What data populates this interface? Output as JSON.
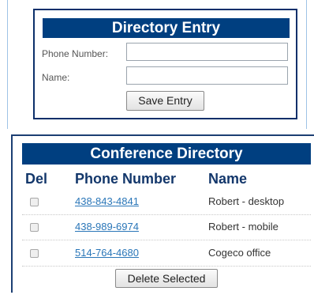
{
  "entry": {
    "title": "Directory Entry",
    "phone_label": "Phone Number:",
    "phone_value": "",
    "name_label": "Name:",
    "name_value": "",
    "save_label": "Save Entry"
  },
  "directory": {
    "title": "Conference Directory",
    "columns": {
      "del": "Del",
      "phone": "Phone Number",
      "name": "Name"
    },
    "rows": [
      {
        "phone": "438-843-4841",
        "name": "Robert - desktop",
        "checked": false
      },
      {
        "phone": "438-989-6974",
        "name": "Robert - mobile",
        "checked": false
      },
      {
        "phone": "514-764-4680",
        "name": "Cogeco office",
        "checked": false
      }
    ],
    "delete_label": "Delete Selected"
  },
  "colors": {
    "header_bg": "#003f80",
    "border": "#0b2f6a",
    "link": "#2a76b8"
  }
}
